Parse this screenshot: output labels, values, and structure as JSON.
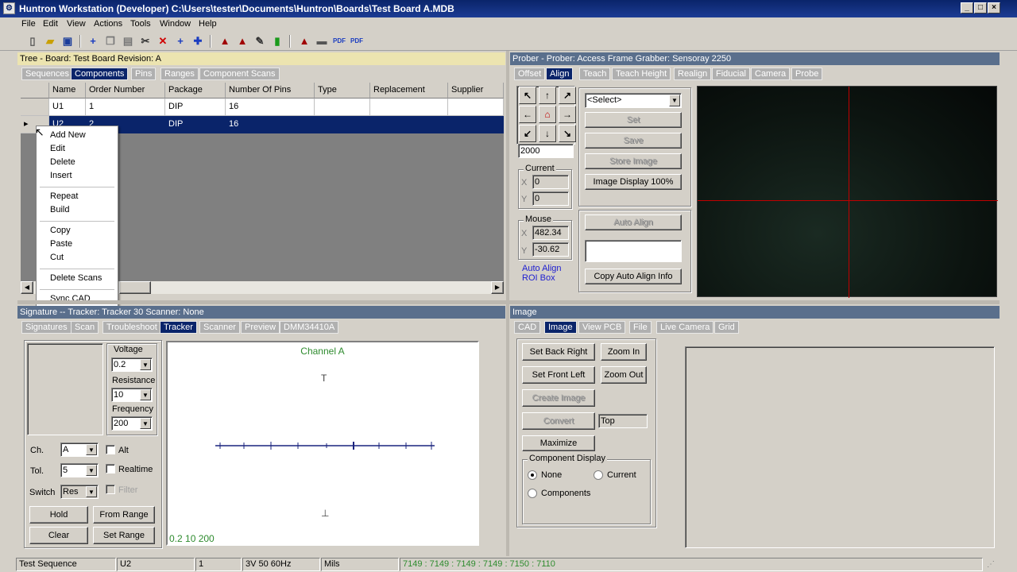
{
  "window": {
    "title": "Huntron Workstation (Developer) C:\\Users\\tester\\Documents\\Huntron\\Boards\\Test Board A.MDB",
    "controls": [
      "_",
      "□",
      "×"
    ]
  },
  "menu": [
    "File",
    "Edit",
    "View",
    "Actions",
    "Tools",
    "Window",
    "Help"
  ],
  "tree_panel": {
    "header": "Tree - Board: Test Board  Revision: A",
    "tabs": [
      "Sequences",
      "Components",
      "Pins",
      "Ranges",
      "Component Scans"
    ],
    "selected_tab": "Components",
    "columns": [
      "Name",
      "Order Number",
      "Package",
      "Number Of Pins",
      "Type",
      "Replacement",
      "Supplier"
    ],
    "rows": [
      {
        "name": "U1",
        "order": "1",
        "package": "DIP",
        "pins": "16",
        "type": "",
        "replacement": "",
        "supplier": ""
      },
      {
        "name": "U2",
        "order": "2",
        "package": "DIP",
        "pins": "16",
        "type": "",
        "replacement": "",
        "supplier": ""
      }
    ],
    "context_menu": [
      "Add New",
      "Edit",
      "Delete",
      "Insert",
      "Repeat",
      "Build",
      "Copy",
      "Paste",
      "Cut",
      "Delete Scans",
      "Sync CAD"
    ]
  },
  "prober_panel": {
    "header": "Prober - Prober: Access Frame Grabber: Sensoray 2250",
    "tabs": [
      "Offset",
      "Align",
      "Teach",
      "Teach Height",
      "Realign",
      "Fiducial",
      "Camera",
      "Probe"
    ],
    "selected_tab": "Align",
    "step_value": "2000",
    "current_label": "Current",
    "current_x": "0",
    "current_y": "0",
    "mouse_label": "Mouse",
    "mouse_x": "482.34",
    "mouse_y": "-30.62",
    "x_label": "X",
    "y_label": "Y",
    "select_value": "<Select>",
    "buttons": {
      "set": "Set",
      "save": "Save",
      "store_image": "Store Image",
      "image_display": "Image Display 100%",
      "auto_align": "Auto Align",
      "copy_auto_align": "Copy Auto Align Info"
    },
    "auto_align_roi": "Auto Align ROI Box"
  },
  "signature_panel": {
    "header": "Signature -- Tracker: Tracker 30  Scanner: None",
    "tabs": [
      "Signatures",
      "Scan",
      "Troubleshoot",
      "Tracker",
      "Scanner",
      "Preview",
      "DMM34410A"
    ],
    "selected_tab": "Tracker",
    "voltage_label": "Voltage",
    "voltage": "0.2",
    "resistance_label": "Resistance",
    "resistance": "10",
    "frequency_label": "Frequency",
    "frequency": "200",
    "ch_label": "Ch.",
    "ch": "A",
    "tol_label": "Tol.",
    "tol": "5",
    "switch_label": "Switch",
    "switch": "Res",
    "alt_label": "Alt",
    "realtime_label": "Realtime",
    "filter_label": "Filter",
    "buttons": {
      "hold": "Hold",
      "from_range": "From Range",
      "clear": "Clear",
      "set_range": "Set Range"
    },
    "channel_title": "Channel A",
    "plot_footer": "0.2 10 200",
    "top_marker": "T",
    "bottom_marker": "⊥"
  },
  "image_panel": {
    "header": "Image",
    "tabs": [
      "CAD",
      "Image",
      "View PCB",
      "File",
      "Live Camera",
      "Grid"
    ],
    "selected_tab": "Image",
    "buttons": {
      "set_back_right": "Set Back Right",
      "zoom_in": "Zoom In",
      "set_front_left": "Set Front Left",
      "zoom_out": "Zoom Out",
      "create_image": "Create Image",
      "convert": "Convert",
      "maximize": "Maximize"
    },
    "convert_field": "Top",
    "component_display_label": "Component Display",
    "radio_none": "None",
    "radio_current": "Current",
    "radio_components": "Components"
  },
  "status": {
    "sequence": "Test Sequence",
    "component": "U2",
    "pin": "1",
    "signal": "3V 50 60Hz",
    "units": "Mils",
    "counts": "7149 : 7149 : 7149 : 7149 : 7150 : 7110"
  },
  "colors": {
    "selection": "#0a246a",
    "crosshair": "#c00000",
    "plot_trace": "#1a237e",
    "channel_text": "#2e8b2e"
  }
}
